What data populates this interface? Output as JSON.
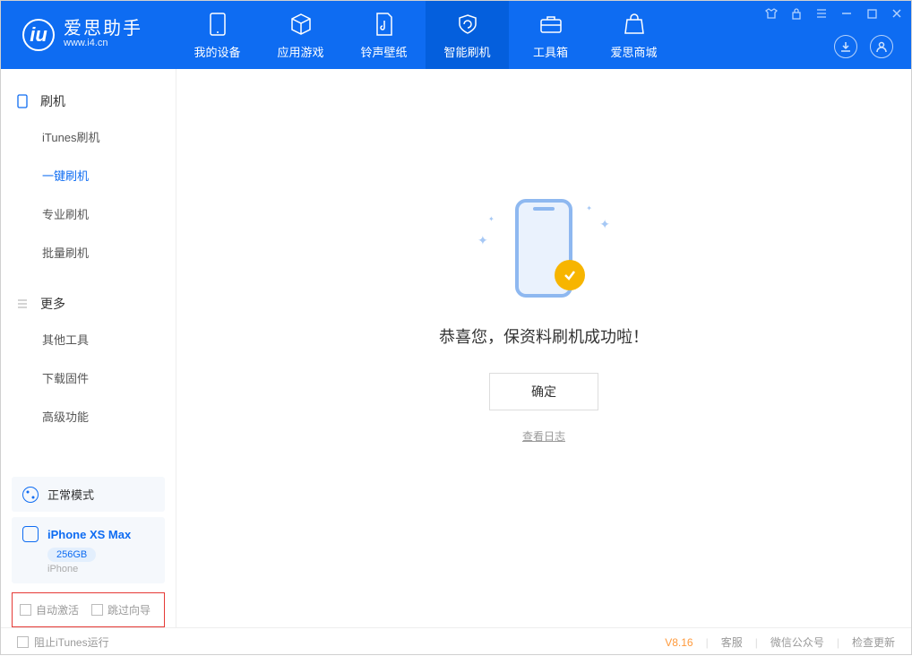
{
  "app": {
    "title": "爱思助手",
    "subtitle": "www.i4.cn"
  },
  "nav": {
    "items": [
      {
        "label": "我的设备"
      },
      {
        "label": "应用游戏"
      },
      {
        "label": "铃声壁纸"
      },
      {
        "label": "智能刷机"
      },
      {
        "label": "工具箱"
      },
      {
        "label": "爱思商城"
      }
    ]
  },
  "sidebar": {
    "sections": [
      {
        "title": "刷机",
        "items": [
          "iTunes刷机",
          "一键刷机",
          "专业刷机",
          "批量刷机"
        ]
      },
      {
        "title": "更多",
        "items": [
          "其他工具",
          "下载固件",
          "高级功能"
        ]
      }
    ],
    "mode": "正常模式",
    "device": {
      "name": "iPhone XS Max",
      "capacity": "256GB",
      "type": "iPhone"
    },
    "options": {
      "auto_activate": "自动激活",
      "skip_guide": "跳过向导"
    }
  },
  "main": {
    "success_text": "恭喜您，保资料刷机成功啦！",
    "ok_button": "确定",
    "view_log": "查看日志"
  },
  "footer": {
    "block_itunes": "阻止iTunes运行",
    "version": "V8.16",
    "links": [
      "客服",
      "微信公众号",
      "检查更新"
    ]
  }
}
